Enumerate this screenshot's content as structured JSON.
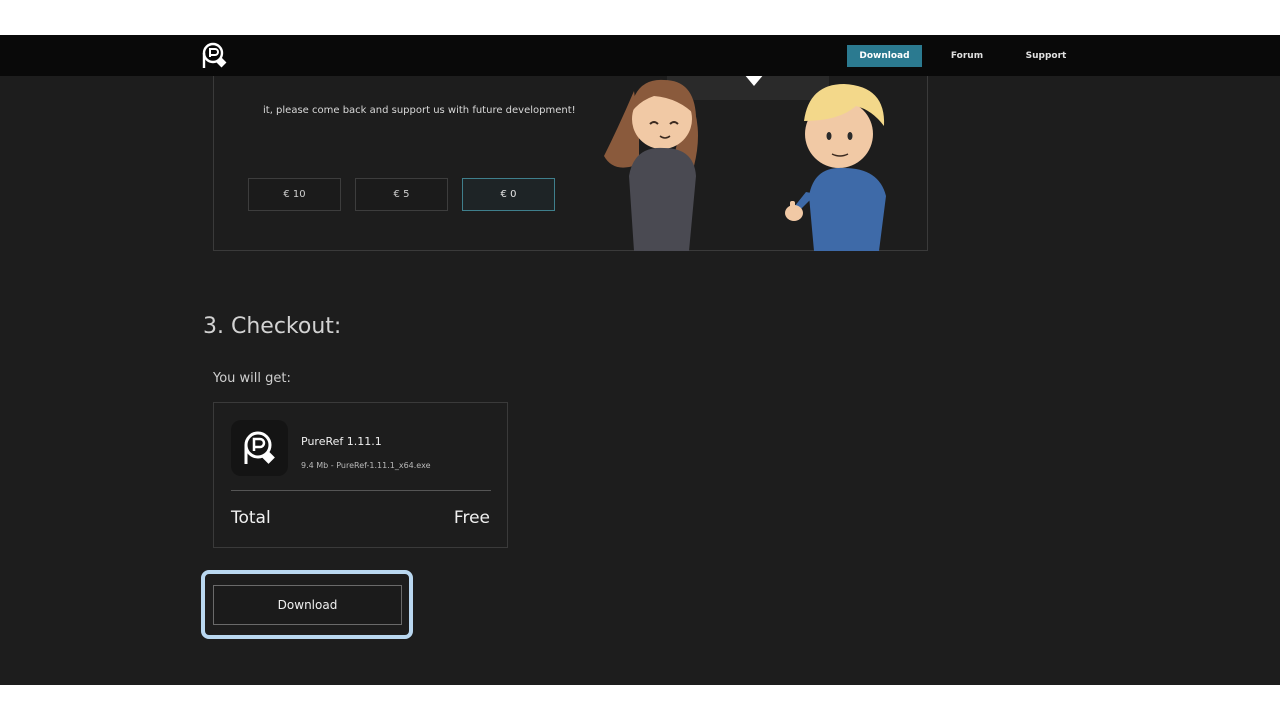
{
  "nav": {
    "download_label": "Download",
    "forum_label": "Forum",
    "support_label": "Support"
  },
  "donation": {
    "text": "it, please come back and support us with future development!",
    "options": [
      "€ 10",
      "€ 5",
      "€ 0"
    ],
    "selected_index": 2
  },
  "checkout": {
    "title": "3. Checkout:",
    "subtitle": "You will get:",
    "product_name": "PureRef 1.11.1",
    "product_file": "9.4 Mb - PureRef-1.11.1_x64.exe",
    "total_label": "Total",
    "total_value": "Free",
    "download_label": "Download"
  },
  "colors": {
    "accent": "#2b7a90",
    "background": "#1d1d1d",
    "navbar": "#090909",
    "focus_ring": "#b9d7f0"
  }
}
